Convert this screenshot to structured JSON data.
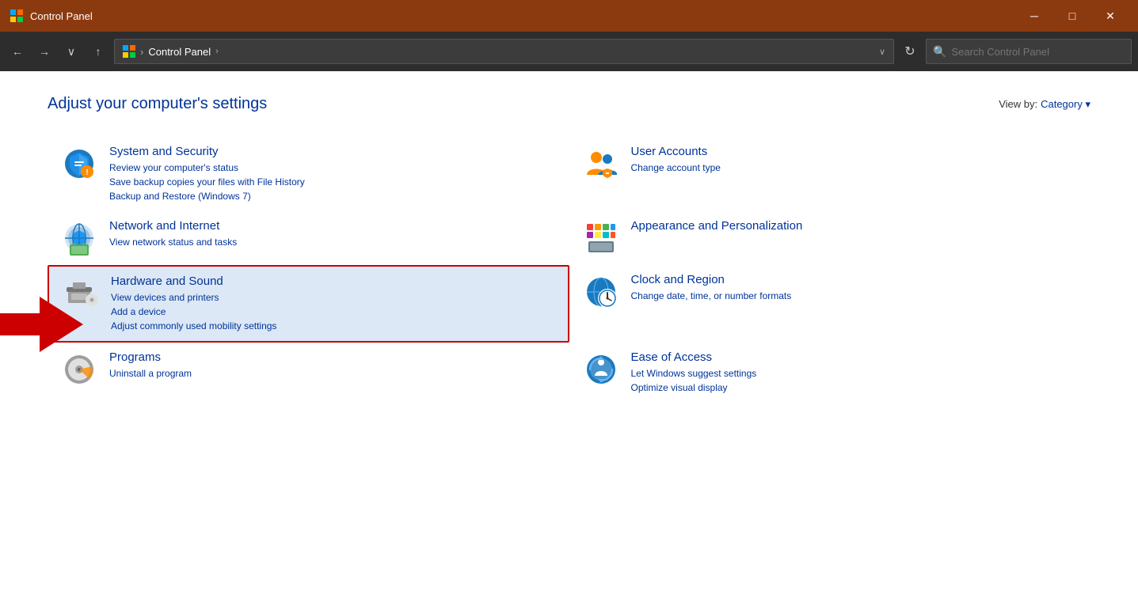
{
  "titlebar": {
    "app_name": "Control Panel",
    "min_label": "─",
    "max_label": "□",
    "close_label": "✕"
  },
  "addressbar": {
    "breadcrumb": "Control Panel",
    "search_placeholder": "Search Control Panel",
    "refresh_symbol": "↻",
    "nav_back": "←",
    "nav_forward": "→",
    "nav_recent": "∨",
    "nav_up": "↑"
  },
  "page": {
    "title": "Adjust your computer's settings",
    "viewby_label": "View by:",
    "viewby_value": "Category"
  },
  "categories": [
    {
      "id": "system-security",
      "title": "System and Security",
      "links": [
        "Review your computer's status",
        "Save backup copies your files with File History",
        "Backup and Restore (Windows 7)"
      ],
      "highlighted": false
    },
    {
      "id": "user-accounts",
      "title": "User Accounts",
      "links": [
        "Change account type"
      ],
      "highlighted": false
    },
    {
      "id": "network-internet",
      "title": "Network and Internet",
      "links": [
        "View network status and tasks"
      ],
      "highlighted": false
    },
    {
      "id": "appearance-personalization",
      "title": "Appearance and Personalization",
      "links": [],
      "highlighted": false
    },
    {
      "id": "hardware-sound",
      "title": "Hardware and Sound",
      "links": [
        "View devices and printers",
        "Add a device",
        "Adjust commonly used mobility settings"
      ],
      "highlighted": true
    },
    {
      "id": "clock-region",
      "title": "Clock and Region",
      "links": [
        "Change date, time, or number formats"
      ],
      "highlighted": false
    },
    {
      "id": "programs",
      "title": "Programs",
      "links": [
        "Uninstall a program"
      ],
      "highlighted": false
    },
    {
      "id": "ease-of-access",
      "title": "Ease of Access",
      "links": [
        "Let Windows suggest settings",
        "Optimize visual display"
      ],
      "highlighted": false
    }
  ]
}
